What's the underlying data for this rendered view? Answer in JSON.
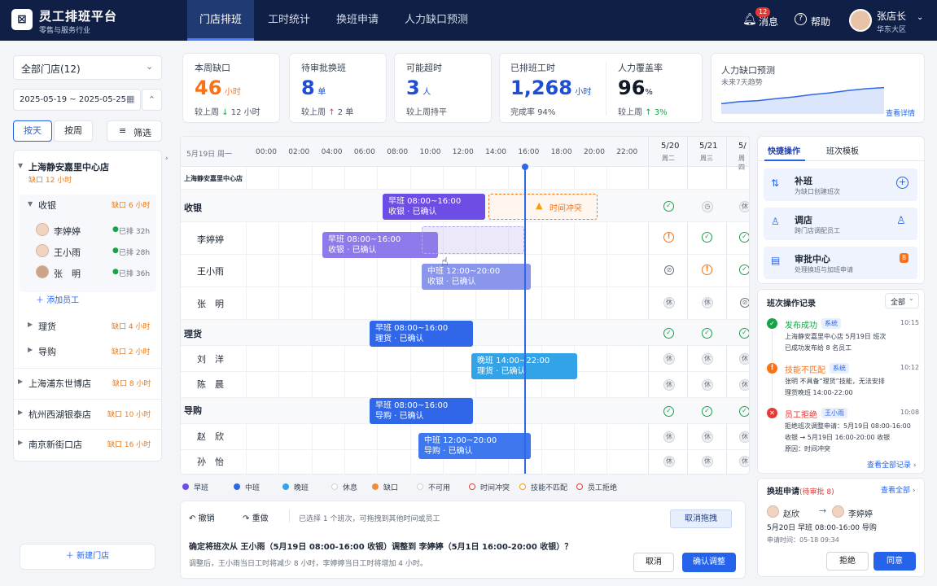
{
  "app": {
    "logo": "⊠",
    "title": "灵工排班平台",
    "subtitle": "零售与服务行业"
  },
  "nav": {
    "tabs": [
      "门店排班",
      "工时统计",
      "换班申请",
      "人力缺口预测"
    ],
    "active": 0
  },
  "header": {
    "bell_badge": "12",
    "msg_label": "消息",
    "help_label": "帮助",
    "user_name": "张店长",
    "user_region": "华东大区"
  },
  "sidebar": {
    "store_select": "全部门店(12)",
    "date_range": "2025-05-19 ~ 2025-05-25",
    "view_day": "按天",
    "view_week": "按周",
    "filter": "筛选",
    "stores": [
      {
        "name": "上海静安嘉里中心店",
        "gap": "缺口 12 小时"
      },
      {
        "name": "上海浦东世博店",
        "gap": "缺口 8 小时"
      },
      {
        "name": "杭州西湖银泰店",
        "gap": "缺口 10 小时"
      },
      {
        "name": "南京新街口店",
        "gap": "缺口 16 小时"
      }
    ],
    "groups": [
      {
        "name": "收银",
        "gap": "缺口 6 小时"
      },
      {
        "name": "理货",
        "gap": "缺口 4 小时"
      },
      {
        "name": "导购",
        "gap": "缺口 2 小时"
      }
    ],
    "staff": [
      {
        "name": "李婷婷",
        "hours": "已排 32h"
      },
      {
        "name": "王小雨",
        "hours": "已排 28h"
      },
      {
        "name": "张　明",
        "hours": "已排 36h"
      }
    ],
    "add_staff": "添加员工",
    "new_store": "新建门店"
  },
  "stats": [
    {
      "label": "本周缺口",
      "value": "46",
      "unit": "小时",
      "cmp": "较上周",
      "delta": "12 小时",
      "arrow": "↓"
    },
    {
      "label": "待审批换班",
      "value": "8",
      "unit": "单",
      "cmp": "较上周",
      "delta": "2 单",
      "arrow": "↑"
    },
    {
      "label": "可能超时",
      "value": "3",
      "unit": "人",
      "cmp": "较上周持平",
      "delta": "",
      "arrow": ""
    },
    {
      "label": "已排班工时",
      "value": "1,268",
      "unit": "小时",
      "cmp": "完成率 94%",
      "delta": "",
      "arrow": ""
    },
    {
      "label": "人力覆盖率",
      "value": "96",
      "unit": "%",
      "cmp": "较上周",
      "delta": "3%",
      "arrow": "↑"
    }
  ],
  "forecast": {
    "title": "人力缺口预测",
    "subtitle": "未来7天趋势",
    "link": "查看详情",
    "trend": [
      0.35,
      0.42,
      0.45,
      0.52,
      0.58,
      0.66,
      0.72,
      0.8,
      0.86,
      0.9
    ]
  },
  "schedule": {
    "date_label": "5月19日 周一",
    "hours": [
      "00:00",
      "02:00",
      "04:00",
      "06:00",
      "08:00",
      "10:00",
      "12:00",
      "14:00",
      "16:00",
      "18:00",
      "20:00",
      "22:00"
    ],
    "days": [
      {
        "date": "5/20",
        "wd": "周二"
      },
      {
        "date": "5/21",
        "wd": "周三"
      },
      {
        "date": "5/",
        "wd": "周四"
      }
    ],
    "store_row": "上海静安嘉里中心店",
    "rows": [
      "收银",
      "李婷婷",
      "王小雨",
      "张　明",
      "理货",
      "刘　洋",
      "陈　晨",
      "导购",
      "赵　欣",
      "孙　怡"
    ],
    "shifts": [
      {
        "line1": "早班  08:00~16:00",
        "line2": "收银 · 已确认"
      },
      {
        "line1": "早班  08:00~16:00",
        "line2": "收银 · 已确认"
      },
      {
        "line1": "中班  12:00~20:00",
        "line2": "收银 · 已确认"
      },
      {
        "line1": "早班  08:00~16:00",
        "line2": "理货 · 已确认"
      },
      {
        "line1": "晚班  14:00~22:00",
        "line2": "理货 · 已确认"
      },
      {
        "line1": "早班  08:00~16:00",
        "line2": "导购 · 已确认"
      },
      {
        "line1": "中班  12:00~20:00",
        "line2": "导购 · 已确认"
      }
    ],
    "conflict": "时间冲突",
    "rest": "休"
  },
  "legend": [
    "早班",
    "中班",
    "晚班",
    "休息",
    "缺口",
    "不可用",
    "时间冲突",
    "技能不匹配",
    "员工拒绝"
  ],
  "legend_colors": [
    "#6d4de3",
    "#2f67e8",
    "#33a3e8",
    "#cfd3da",
    "#f28c3a",
    "#cfd3da",
    "#e53935",
    "#f59e0b",
    "#e53935"
  ],
  "confirm": {
    "undo": "撤销",
    "redo": "重做",
    "hint": "已选择 1 个班次，可拖拽到其他时间或员工",
    "cancel_drag": "取消拖拽",
    "question": "确定将班次从 王小雨（5月19日 08:00-16:00 收银）调整到 李婷婷（5月1日 16:00-20:00 收银）？",
    "detail": "调整后，王小雨当日工时将减少 8 小时，李婷婷当日工时将增加 4 小时。",
    "cancel": "取消",
    "ok": "确认调整"
  },
  "right": {
    "tabs": [
      "快捷操作",
      "班次模板"
    ],
    "actions": [
      {
        "title": "补班",
        "desc": "为缺口创建班次"
      },
      {
        "title": "调店",
        "desc": "跨门店调配员工"
      },
      {
        "title": "审批中心",
        "desc": "处理换班与加班申请",
        "badge": "8"
      }
    ],
    "log_title": "班次操作记录",
    "log_filter": "全部",
    "logs": [
      {
        "title": "发布成功",
        "tag": "系统",
        "time": "10:15",
        "text1": "上海静安嘉里中心店 5月19日 班次",
        "text2": "已成功发布给 8 名员工"
      },
      {
        "title": "技能不匹配",
        "tag": "系统",
        "time": "10:12",
        "text1": "张明 不具备“理货”技能，无法安排",
        "text2": "理货晚班 14:00-22:00"
      },
      {
        "title": "员工拒绝",
        "tag": "王小雨",
        "time": "10:08",
        "text1": "拒绝班次调整申请：5月19日 08:00-16:00",
        "text2": "收银 → 5月19日 16:00-20:00 收银",
        "text3": "原因：时间冲突"
      }
    ],
    "log_link": "查看全部记录",
    "swap_title": "换班申请",
    "swap_pending": "(待审批 8)",
    "swap_link": "查看全部",
    "swap_from": "赵欣",
    "swap_to": "李婷婷",
    "swap_shift": "5月20日  早班  08:00-16:00  导购",
    "swap_time": "申请时间：05-18 09:34",
    "reject": "拒绝",
    "approve": "同意"
  }
}
